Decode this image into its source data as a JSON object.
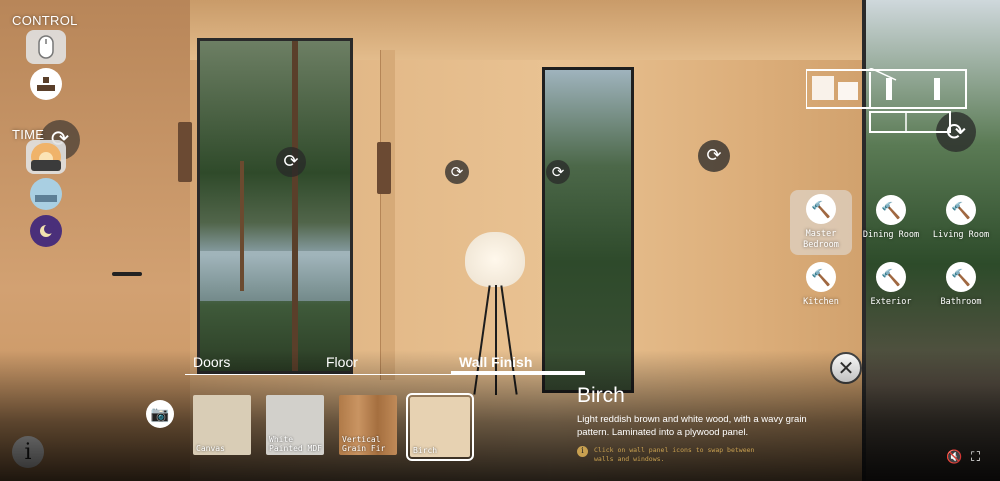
{
  "left_panel": {
    "control_label": "CONTROL",
    "time_label": "TIME",
    "info_label": "i"
  },
  "rooms": [
    {
      "label": "Master Bedroom",
      "selected": true
    },
    {
      "label": "Dining Room",
      "selected": false
    },
    {
      "label": "Living Room",
      "selected": false
    },
    {
      "label": "Kitchen",
      "selected": false
    },
    {
      "label": "Exterior",
      "selected": false
    },
    {
      "label": "Bathroom",
      "selected": false
    }
  ],
  "tabs": [
    {
      "label": "Doors",
      "active": false
    },
    {
      "label": "Floor",
      "active": false
    },
    {
      "label": "Wall Finish",
      "active": true
    }
  ],
  "swatches": [
    {
      "label": "Canvas",
      "color": "#d9cdb6"
    },
    {
      "label": "White Painted MDF",
      "color": "#d2d0cb"
    },
    {
      "label": "Vertical Grain Fir",
      "color": "#b98555"
    },
    {
      "label": "Birch",
      "color": "#e7d2b2",
      "selected": true
    }
  ],
  "detail": {
    "title": "Birch",
    "description": "Light reddish brown and white wood, with a wavy grain pattern. Laminated into a plywood panel.",
    "hint": "Click on wall panel icons to swap between walls and windows."
  },
  "colors": {
    "accent_hint": "#c8a050",
    "selected_bg": "#e1e1e1"
  },
  "icons": {
    "hotspot": "rotate-icon",
    "room": "hammer-icon",
    "close": "close-icon",
    "camera": "camera-icon",
    "mute": "mute-icon",
    "fullscreen": "fullscreen-icon"
  }
}
